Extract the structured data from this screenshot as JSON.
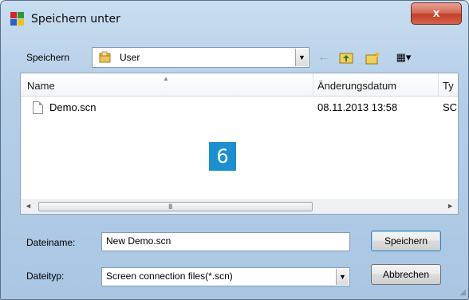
{
  "window": {
    "title": "Speichern unter",
    "close_label": "x"
  },
  "location": {
    "label": "Speichern",
    "value": "User"
  },
  "toolbar": {
    "back_glyph": "←",
    "up_glyph": "⬆",
    "newfolder_glyph": "✨",
    "views_glyph": "▦▾"
  },
  "list": {
    "columns": [
      "Name",
      "Änderungsdatum",
      "Ty"
    ],
    "rows": [
      {
        "name": "Demo.scn",
        "date": "08.11.2013 13:58",
        "type": "SC"
      }
    ],
    "overlay_number": "6",
    "scroll_left": "◄",
    "scroll_right": "►",
    "scroll_grip": "III"
  },
  "filename": {
    "label": "Dateiname:",
    "value": "New Demo.scn"
  },
  "filetype": {
    "label": "Dateityp:",
    "value": "Screen connection files(*.scn)"
  },
  "buttons": {
    "save": "Speichern",
    "cancel": "Abbrechen"
  },
  "colors": {
    "accent_badge": "#1b8fd0",
    "close_red": "#c2402a"
  }
}
